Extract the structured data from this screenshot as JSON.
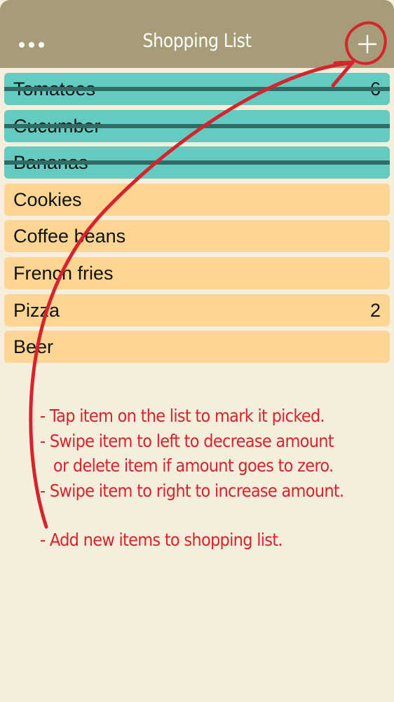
{
  "header": {
    "title": "Shopping List",
    "menu_icon": "more-dots-icon",
    "add_icon": "plus-icon"
  },
  "items": [
    {
      "name": "Tomatoes",
      "qty": "6",
      "picked": true
    },
    {
      "name": "Cucumber",
      "qty": "",
      "picked": true
    },
    {
      "name": "Bananas",
      "qty": "",
      "picked": true
    },
    {
      "name": "Cookies",
      "qty": "",
      "picked": false
    },
    {
      "name": "Coffee beans",
      "qty": "",
      "picked": false
    },
    {
      "name": "French fries",
      "qty": "",
      "picked": false
    },
    {
      "name": "Pizza",
      "qty": "2",
      "picked": false
    },
    {
      "name": "Beer",
      "qty": "",
      "picked": false
    }
  ],
  "instructions": {
    "line1": "- Tap item on the list to mark it picked.",
    "line2": "- Swipe item to left to decrease amount",
    "line3": "or delete item if amount goes to zero.",
    "line4": "- Swipe item to right to increase amount.",
    "line5": "- Add new items to shopping list."
  },
  "colors": {
    "header": "#a69c78",
    "background": "#f6eedc",
    "picked_item": "#64cbc0",
    "pending_item": "#fed592",
    "strike": "#326b66",
    "annotation": "#d8232d"
  }
}
